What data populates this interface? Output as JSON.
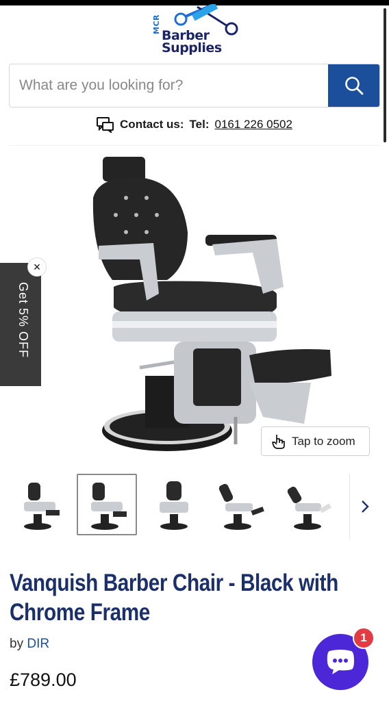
{
  "header": {
    "logo": {
      "mcr": "MCR",
      "line1": "Barber",
      "line2": "Supplies"
    },
    "search": {
      "placeholder": "What are you looking for?"
    },
    "contact": {
      "label": "Contact us:",
      "tel_label": "Tel:",
      "tel_number": "0161 226 0502"
    }
  },
  "promo": {
    "text": "Get 5% OFF",
    "close_label": "×"
  },
  "gallery": {
    "zoom_label": "Tap to zoom",
    "thumbnails": [
      {
        "alt": "chair-front-angle"
      },
      {
        "alt": "chair-side-angle"
      },
      {
        "alt": "chair-front"
      },
      {
        "alt": "chair-reclined"
      },
      {
        "alt": "chair-reclined-side"
      }
    ],
    "active_index": 1
  },
  "product": {
    "title": "Vanquish Barber Chair - Black with Chrome Frame",
    "by_prefix": "by",
    "vendor": "DIR",
    "price": "£789.00"
  },
  "chat": {
    "badge_count": "1"
  },
  "colors": {
    "brand_blue": "#1b4f9c",
    "title_navy": "#1b2f6b",
    "chat_purple": "#4b27d8",
    "badge_red": "#e23b44"
  }
}
